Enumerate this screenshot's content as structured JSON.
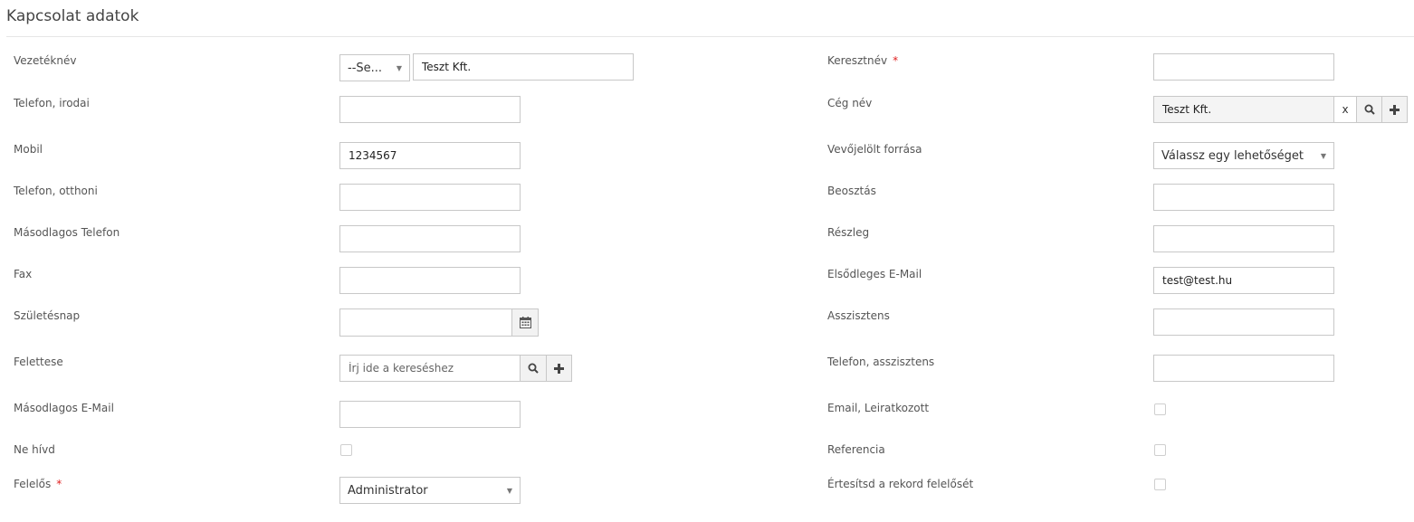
{
  "title": "Kapcsolat adatok",
  "left": {
    "vezeteknev": {
      "label": "Vezetéknév",
      "salutation": "--Se...",
      "value": "Teszt Kft."
    },
    "telefon_irodai": {
      "label": "Telefon, irodai",
      "value": ""
    },
    "mobil": {
      "label": "Mobil",
      "value": "1234567"
    },
    "telefon_otthoni": {
      "label": "Telefon, otthoni",
      "value": ""
    },
    "masodlagos_telefon": {
      "label": "Másodlagos Telefon",
      "value": ""
    },
    "fax": {
      "label": "Fax",
      "value": ""
    },
    "szuletesnap": {
      "label": "Születésnap",
      "value": ""
    },
    "felettese": {
      "label": "Felettese",
      "placeholder": "Írj ide a kereséshez"
    },
    "masodlagos_email": {
      "label": "Másodlagos E-Mail",
      "value": ""
    },
    "ne_hivd": {
      "label": "Ne hívd",
      "checked": false
    },
    "felelos": {
      "label": "Felelős",
      "required": "*",
      "value": "Administrator"
    }
  },
  "right": {
    "keresztnev": {
      "label": "Keresztnév",
      "required": "*",
      "value": ""
    },
    "ceg_nev": {
      "label": "Cég név",
      "value": "Teszt Kft.",
      "clear": "x"
    },
    "vevojelolt_forrasa": {
      "label": "Vevőjelölt forrása",
      "value": "Válassz egy lehetőséget"
    },
    "beosztas": {
      "label": "Beosztás",
      "value": ""
    },
    "reszleg": {
      "label": "Részleg",
      "value": ""
    },
    "elsodleges_email": {
      "label": "Elsődleges E-Mail",
      "value": "test@test.hu"
    },
    "asszisztens": {
      "label": "Asszisztens",
      "value": ""
    },
    "telefon_asszisztens": {
      "label": "Telefon, asszisztens",
      "value": ""
    },
    "email_leiratkozott": {
      "label": "Email, Leiratkozott",
      "checked": false
    },
    "referencia": {
      "label": "Referencia",
      "checked": false
    },
    "ertesitsd": {
      "label": "Értesítsd a rekord felelősét",
      "checked": false
    }
  },
  "icons": {
    "caret": "▼",
    "search": "search-icon",
    "plus": "plus-icon",
    "calendar": "calendar-icon"
  }
}
